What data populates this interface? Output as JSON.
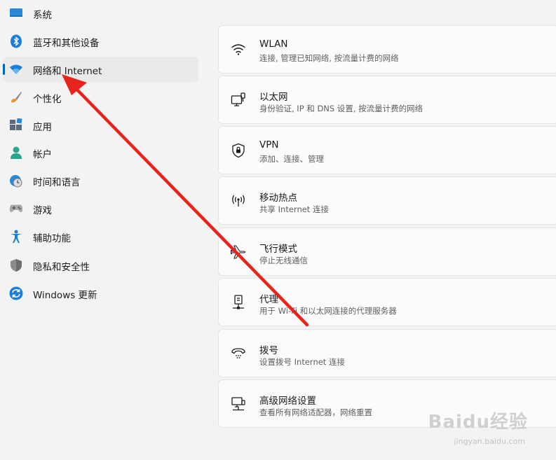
{
  "sidebar": {
    "items": [
      {
        "label": "系统",
        "icon": "system-monitor-icon"
      },
      {
        "label": "蓝牙和其他设备",
        "icon": "bluetooth-icon"
      },
      {
        "label": "网络和 Internet",
        "icon": "wifi-icon",
        "selected": true
      },
      {
        "label": "个性化",
        "icon": "paintbrush-icon"
      },
      {
        "label": "应用",
        "icon": "apps-icon"
      },
      {
        "label": "帐户",
        "icon": "account-icon"
      },
      {
        "label": "时间和语言",
        "icon": "clock-globe-icon"
      },
      {
        "label": "游戏",
        "icon": "gamepad-icon"
      },
      {
        "label": "辅助功能",
        "icon": "accessibility-icon"
      },
      {
        "label": "隐私和安全性",
        "icon": "shield-icon"
      },
      {
        "label": "Windows 更新",
        "icon": "update-icon"
      }
    ]
  },
  "main": {
    "cards": [
      {
        "title": "WLAN",
        "subtitle": "连接, 管理已知网络, 按流量计费的网络",
        "icon": "wifi-icon"
      },
      {
        "title": "以太网",
        "subtitle": "身份验证, IP 和 DNS 设置, 按流量计费的网络",
        "icon": "ethernet-icon"
      },
      {
        "title": "VPN",
        "subtitle": "添加、连接、管理",
        "icon": "vpn-shield-icon"
      },
      {
        "title": "移动热点",
        "subtitle": "共享 Internet 连接",
        "icon": "hotspot-icon"
      },
      {
        "title": "飞行模式",
        "subtitle": "停止无线通信",
        "icon": "airplane-icon"
      },
      {
        "title": "代理",
        "subtitle": "用于 Wi-Fi 和以太网连接的代理服务器",
        "icon": "proxy-icon"
      },
      {
        "title": "拨号",
        "subtitle": "设置拨号 Internet 连接",
        "icon": "dialup-phone-icon"
      },
      {
        "title": "高级网络设置",
        "subtitle": "查看所有网络适配器，网络重置",
        "icon": "network-computer-icon"
      }
    ]
  },
  "watermark": {
    "brand": "Baidu经验",
    "url": "jingyan.baidu.com"
  },
  "colors": {
    "accent": "#0067c0",
    "arrow": "#e8231b",
    "background": "#f3f3f3",
    "card": "#fbfbfb"
  }
}
